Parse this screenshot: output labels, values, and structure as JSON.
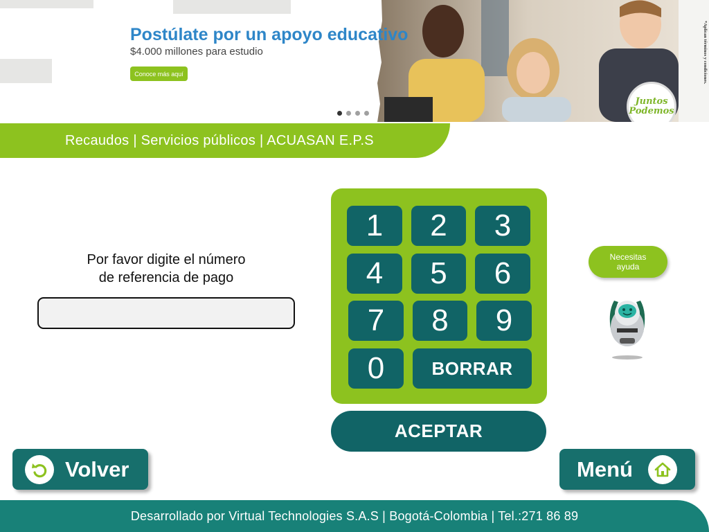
{
  "banner": {
    "title": "Postúlate por un apoyo educativo",
    "subtitle": "$4.000 millones para estudio",
    "cta_label": "Conoce más aquí",
    "side_note": "*Aplican términos y condiciones.",
    "campaign_line1": "Juntos",
    "campaign_line2": "Podemos",
    "carousel_total": 4,
    "carousel_active": 1
  },
  "breadcrumb": {
    "text": "Recaudos | Servicios públicos | ACUASAN E.P.S"
  },
  "form": {
    "prompt_line1": "Por favor digite el número",
    "prompt_line2": "de referencia de pago",
    "reference_value": "",
    "reference_placeholder": ""
  },
  "keypad": {
    "keys": [
      "1",
      "2",
      "3",
      "4",
      "5",
      "6",
      "7",
      "8",
      "9",
      "0"
    ],
    "clear_label": "BORRAR"
  },
  "accept_label": "ACEPTAR",
  "help": {
    "line1": "Necesitas",
    "line2": "ayuda"
  },
  "nav": {
    "back_label": "Volver",
    "menu_label": "Menú"
  },
  "footer": {
    "text": "Desarrollado por Virtual Technologies S.A.S | Bogotá-Colombia | Tel.:271 86 89"
  },
  "colors": {
    "green": "#8dc21f",
    "teal": "#116466",
    "footer_teal": "#188178",
    "banner_blue": "#2e86c8"
  },
  "icons": {
    "back": "undo-arrow-icon",
    "menu": "home-icon",
    "assistant": "robot-icon"
  }
}
